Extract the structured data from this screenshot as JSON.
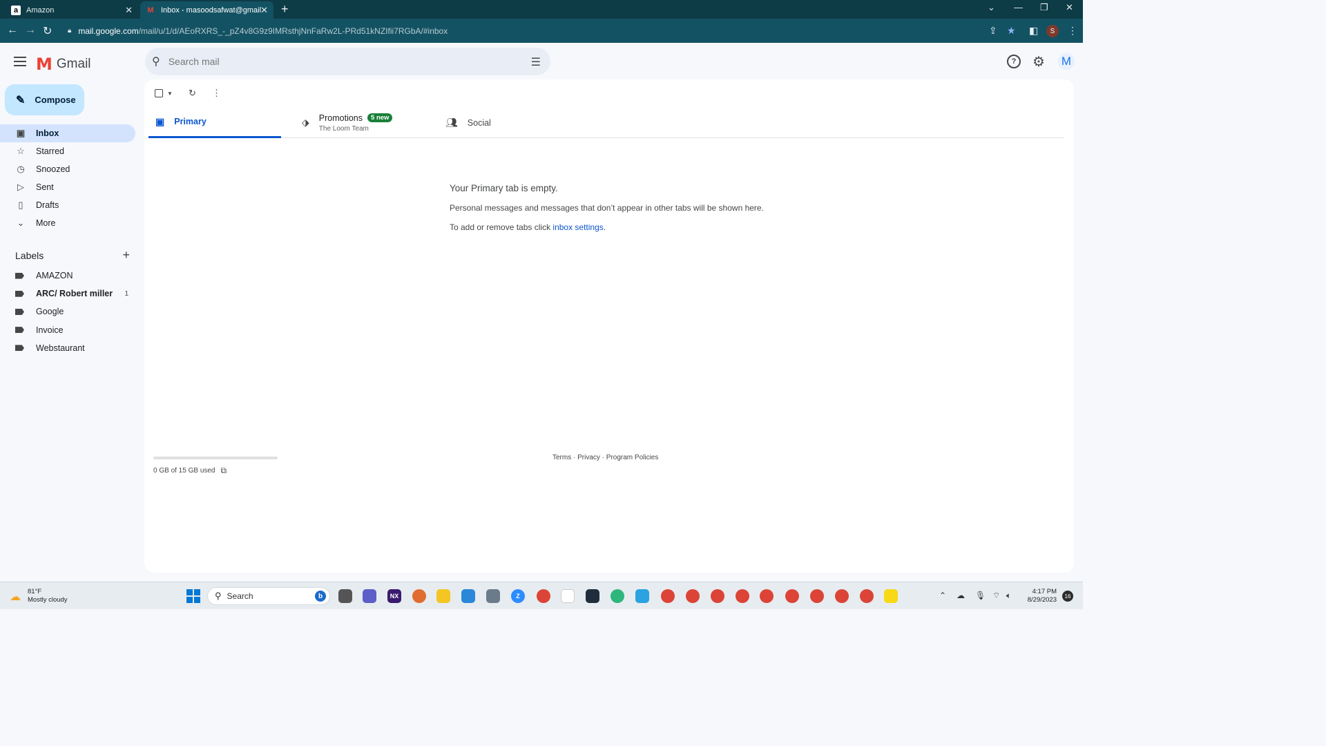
{
  "browser": {
    "tabs": [
      {
        "title": "Amazon",
        "favicon": "amazon-icon"
      },
      {
        "title": "Inbox - masoodsafwat@gmail.co",
        "favicon": "gmail-icon"
      }
    ],
    "url_host": "mail.google.com",
    "url_path": "/mail/u/1/d/AEoRXRS_-_pZ4v8G9z9IMRsthjNnFaRw2L-PRd51kNZIfii7RGbA/#inbox",
    "profile_initial": "S"
  },
  "gmail": {
    "brand": "Gmail",
    "search_placeholder": "Search mail",
    "avatar_initial": "M",
    "compose_label": "Compose",
    "nav": [
      {
        "label": "Inbox",
        "icon": "inbox-icon"
      },
      {
        "label": "Starred",
        "icon": "star-icon"
      },
      {
        "label": "Snoozed",
        "icon": "clock-icon"
      },
      {
        "label": "Sent",
        "icon": "send-icon"
      },
      {
        "label": "Drafts",
        "icon": "draft-icon"
      },
      {
        "label": "More",
        "icon": "chevron-down-icon"
      }
    ],
    "labels_title": "Labels",
    "labels": [
      {
        "name": "AMAZON",
        "count": ""
      },
      {
        "name": "ARC/ Robert miller",
        "count": "1"
      },
      {
        "name": "Google",
        "count": ""
      },
      {
        "name": "Invoice",
        "count": ""
      },
      {
        "name": "Webstaurant",
        "count": ""
      }
    ],
    "tabs": {
      "primary": "Primary",
      "promotions": "Promotions",
      "promotions_badge": "5 new",
      "promotions_sender": "The Loom Team",
      "social": "Social"
    },
    "empty": {
      "title": "Your Primary tab is empty.",
      "line1": "Personal messages and messages that don’t appear in other tabs will be shown here.",
      "line2_prefix": "To add or remove tabs click ",
      "line2_link": "inbox settings",
      "line2_suffix": "."
    },
    "storage": {
      "text": "0 GB of 15 GB used",
      "fraction_used": 0.0
    },
    "footer": "Terms · Privacy · Program Policies"
  },
  "taskbar": {
    "temperature": "81°F",
    "weather": "Mostly cloudy",
    "search_label": "Search",
    "time": "4:17 PM",
    "date": "8/29/2023",
    "notifications": "16",
    "colors": {
      "accent": "#0b57d0",
      "compose": "#c2e7ff",
      "active_nav": "#d3e3fd",
      "badge": "#188038"
    }
  }
}
